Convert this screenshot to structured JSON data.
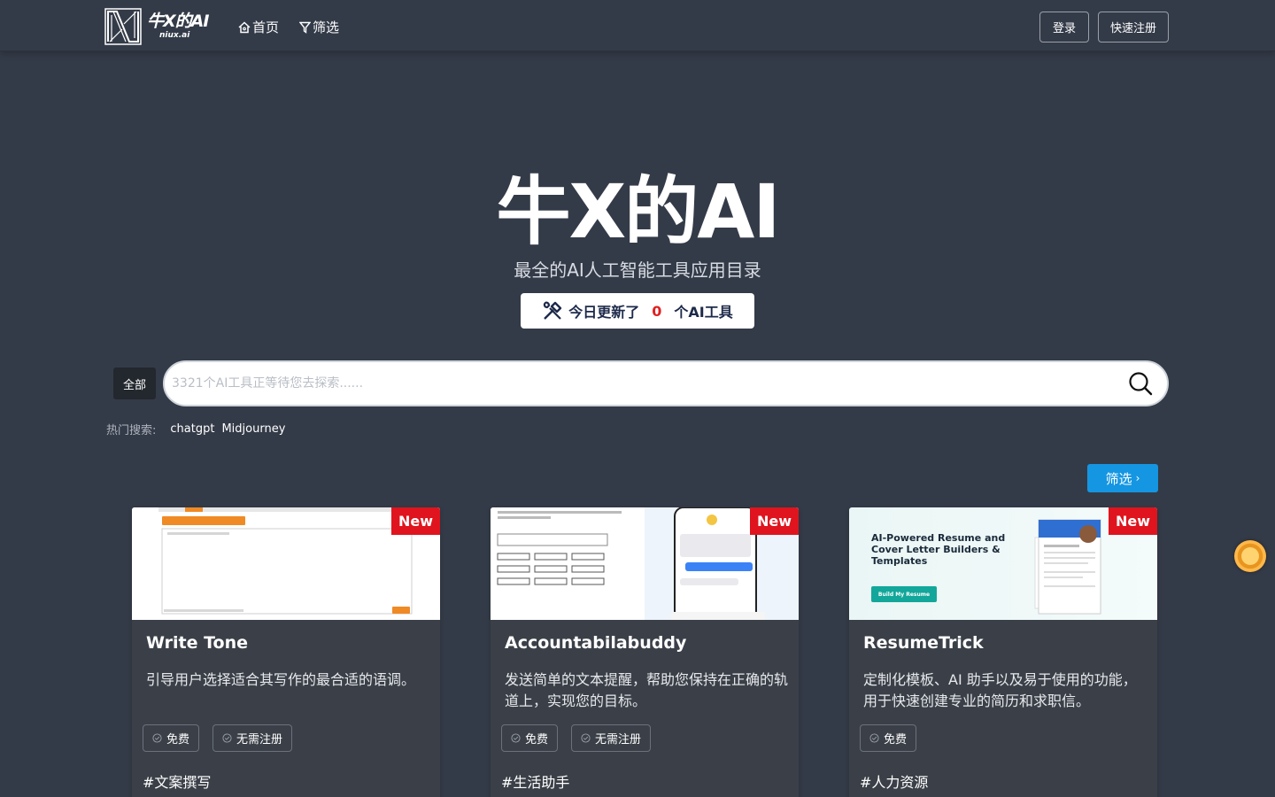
{
  "nav": {
    "logo_title": "牛X的AI",
    "logo_sub": "niux.ai",
    "home_label": "首页",
    "filter_label": "筛选",
    "login_label": "登录",
    "register_label": "快速注册"
  },
  "hero": {
    "title": "牛X的AI",
    "subtitle": "最全的AI人工智能工具应用目录",
    "update_prefix": "今日更新了",
    "update_count": "0",
    "update_suffix": "个AI工具"
  },
  "search": {
    "category": "全部",
    "placeholder": "3321个AI工具正等待您去探索......",
    "hot_label": "热门搜索:",
    "hot_items": [
      "chatgpt",
      "Midjourney"
    ]
  },
  "filter_button": "筛选",
  "cards": [
    {
      "badge": "New",
      "title": "Write Tone",
      "desc": "引导用户选择适合其写作的最合适的语调。",
      "tags": [
        "免费",
        "无需注册"
      ],
      "category": "#文案撰写"
    },
    {
      "badge": "New",
      "title": "Accountabilabuddy",
      "desc": "发送简单的文本提醒，帮助您保持在正确的轨道上，实现您的目标。",
      "tags": [
        "免费",
        "无需注册"
      ],
      "category": "#生活助手"
    },
    {
      "badge": "New",
      "title": "ResumeTrick",
      "desc": "定制化模板、AI 助手以及易于使用的功能，用于快速创建专业的简历和求职信。",
      "tags": [
        "免费"
      ],
      "category": "#人力资源",
      "thumb_headline": "AI-Powered Resume and Cover Letter Builders & Templates",
      "thumb_cta": "Build My Resume"
    }
  ],
  "colors": {
    "background": "#343b48",
    "card": "#3b4048",
    "accent": "#1596e2",
    "new_badge": "#e0141e",
    "update_count": "#e02020"
  }
}
